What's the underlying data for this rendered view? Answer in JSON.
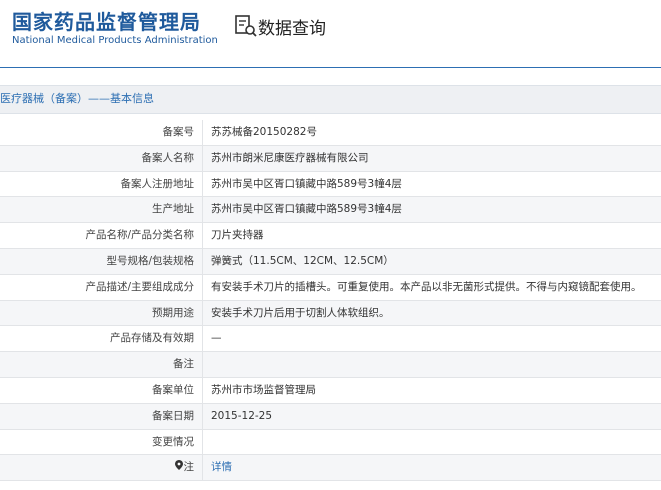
{
  "header": {
    "logo_cn": "国家药品监督管理局",
    "logo_en": "National Medical Products Administration",
    "page_title": "数据查询"
  },
  "breadcrumb": "医疗器械（备案）——基本信息",
  "rows": [
    {
      "label": "备案号",
      "value": "苏苏械备20150282号"
    },
    {
      "label": "备案人名称",
      "value": "苏州市朗米尼康医疗器械有限公司"
    },
    {
      "label": "备案人注册地址",
      "value": "苏州市吴中区胥口镇藏中路589号3幢4层"
    },
    {
      "label": "生产地址",
      "value": "苏州市吴中区胥口镇藏中路589号3幢4层"
    },
    {
      "label": "产品名称/产品分类名称",
      "value": "刀片夹持器"
    },
    {
      "label": "型号规格/包装规格",
      "value": "弹簧式（11.5CM、12CM、12.5CM）"
    },
    {
      "label": "产品描述/主要组成成分",
      "value": "有安装手术刀片的插槽头。可重复使用。本产品以非无菌形式提供。不得与内窥镜配套使用。"
    },
    {
      "label": "预期用途",
      "value": "安装手术刀片后用于切割人体软组织。"
    },
    {
      "label": "产品存储及有效期",
      "value": "—"
    },
    {
      "label": "备注",
      "value": ""
    },
    {
      "label": "备案单位",
      "value": "苏州市市场监督管理局"
    },
    {
      "label": "备案日期",
      "value": "2015-12-25"
    },
    {
      "label": "变更情况",
      "value": ""
    },
    {
      "label": "注",
      "value": "详情",
      "link": true
    }
  ],
  "colors": {
    "brand": "#1f5a9c",
    "link": "#2d6fb3"
  }
}
